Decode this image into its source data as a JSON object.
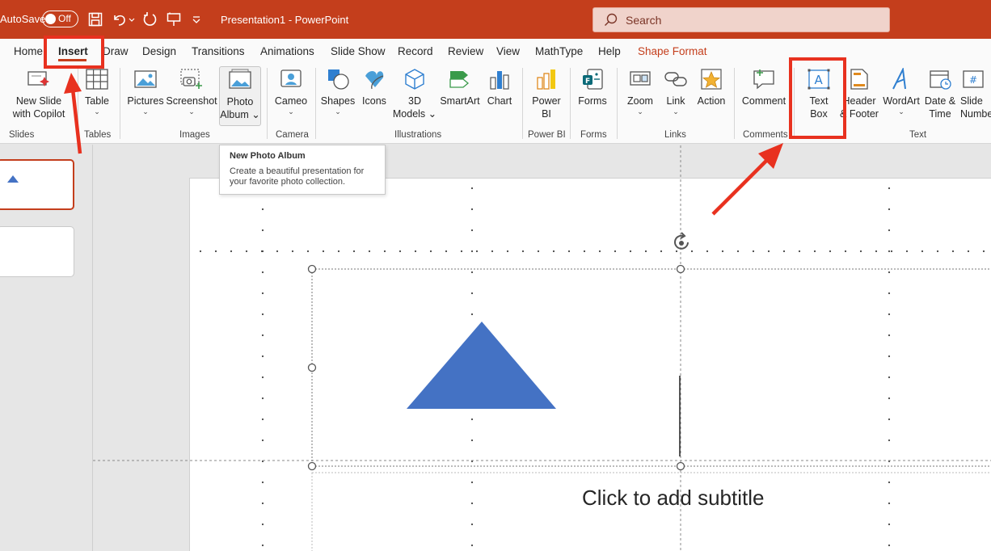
{
  "colors": {
    "accent": "#c43e1c",
    "annotation": "#e8311f",
    "shape_fill": "#4472c4"
  },
  "titlebar": {
    "autosave_label": "AutoSave",
    "autosave_state": "Off",
    "document_title": "Presentation1  -  PowerPoint",
    "search_placeholder": "Search"
  },
  "tabs": [
    {
      "label": "Home"
    },
    {
      "label": "Insert"
    },
    {
      "label": "Draw"
    },
    {
      "label": "Design"
    },
    {
      "label": "Transitions"
    },
    {
      "label": "Animations"
    },
    {
      "label": "Slide Show"
    },
    {
      "label": "Record"
    },
    {
      "label": "Review"
    },
    {
      "label": "View"
    },
    {
      "label": "MathType"
    },
    {
      "label": "Help"
    },
    {
      "label": "Shape Format"
    }
  ],
  "active_tab": "Insert",
  "ribbon": {
    "buttons": {
      "new_slide": [
        "New Slide",
        "with Copilot"
      ],
      "table": "Table",
      "pictures": "Pictures",
      "screenshot": "Screenshot",
      "photo_album": [
        "Photo",
        "Album"
      ],
      "cameo": "Cameo",
      "shapes": "Shapes",
      "icons": "Icons",
      "models_3d": [
        "3D",
        "Models"
      ],
      "smartart": "SmartArt",
      "chart": "Chart",
      "power_bi": [
        "Power",
        "BI"
      ],
      "forms": "Forms",
      "zoom": "Zoom",
      "link": "Link",
      "action": "Action",
      "comment": "Comment",
      "text_box": [
        "Text",
        "Box"
      ],
      "header_footer": [
        "Header",
        "& Footer"
      ],
      "wordart": "WordArt",
      "date_time": [
        "Date &",
        "Time"
      ],
      "slide_number": [
        "Slide",
        "Number"
      ]
    },
    "groups": {
      "slides": "Slides",
      "tables": "Tables",
      "images": "Images",
      "camera": "Camera",
      "illustrations": "Illustrations",
      "power_bi": "Power BI",
      "forms": "Forms",
      "links": "Links",
      "comments": "Comments",
      "text": "Text"
    }
  },
  "tooltip": {
    "title": "New Photo Album",
    "body": "Create a beautiful presentation for your favorite photo collection."
  },
  "slide": {
    "subtitle_placeholder": "Click to add subtitle"
  }
}
